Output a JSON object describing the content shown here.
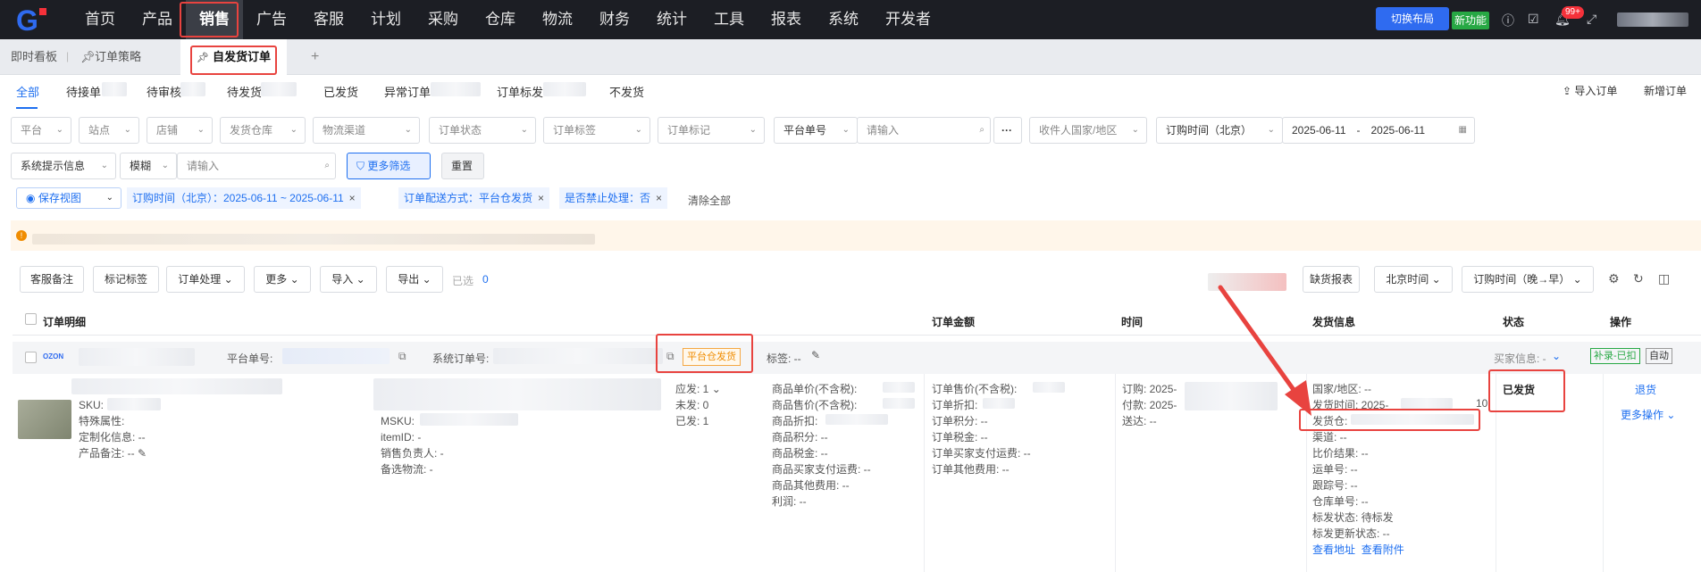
{
  "topnav": {
    "logo": "G",
    "items": [
      "首页",
      "产品",
      "销售",
      "广告",
      "客服",
      "计划",
      "采购",
      "仓库",
      "物流",
      "财务",
      "统计",
      "工具",
      "报表",
      "系统",
      "开发者"
    ],
    "layout_button": "切换布局",
    "new_feature": "新功能",
    "badge": "99+"
  },
  "tabs": {
    "items": [
      "即时看板",
      "订单策略",
      "自发货订单"
    ],
    "add": "+"
  },
  "status_tabs": [
    "全部",
    "待接单",
    "待审核",
    "待发货",
    "已发货",
    "异常订单",
    "订单标发",
    "不发货"
  ],
  "actions": {
    "import": "导入订单",
    "add": "新增订单"
  },
  "filters": {
    "platform": "平台",
    "site": "站点",
    "shop": "店铺",
    "warehouse": "发货仓库",
    "logistics": "物流渠道",
    "order_status": "订单状态",
    "order_tag": "订单标签",
    "order_mark": "订单标记",
    "platform_no": "平台单号",
    "input_placeholder": "请输入",
    "receiver_country": "收件人国家/地区",
    "order_time": "订购时间（北京）",
    "date_from": "2025-06-11",
    "date_sep": "-",
    "date_to": "2025-06-11",
    "sys_info": "系统提示信息",
    "fuzzy": "模糊",
    "more": "更多筛选",
    "reset": "重置"
  },
  "chips": {
    "save_view": "保存视图",
    "c1": "订购时间（北京）：2025-06-11 ~ 2025-06-11",
    "c2": "订单配送方式：平台仓发货",
    "c3": "是否禁止处理：否",
    "clear": "清除全部"
  },
  "toolbar": {
    "note": "客服备注",
    "tag": "标记标签",
    "process": "订单处理",
    "more": "更多",
    "import": "导入",
    "export": "导出",
    "selected_label": "已选",
    "selected_count": "0",
    "shortage": "缺货报表",
    "tz": "北京时间",
    "sort": "订购时间（晚→早）"
  },
  "table": {
    "headers": [
      "订单明细",
      "订单金额",
      "时间",
      "发货信息",
      "状态",
      "操作"
    ]
  },
  "order": {
    "platform": "OZON",
    "platform_no_label": "平台单号:",
    "sys_no_label": "系统订单号:",
    "fulfil": "平台仓发货",
    "tags_label": "标签: --",
    "buyer_label": "买家信息: -",
    "btn_fill": "补录-已扣",
    "btn_auto": "自动",
    "left": [
      "SKU:",
      "特殊属性:",
      "定制化信息: --",
      "产品备注: --"
    ],
    "mid": [
      "MSKU:",
      "itemID: -",
      "销售负责人: -",
      "备选物流: -"
    ],
    "qty": [
      "应发: 1",
      "未发: 0",
      "已发: 1"
    ],
    "price": [
      "商品单价(不含税):",
      "商品售价(不含税):",
      "商品折扣:",
      "商品积分: --",
      "商品税金: --",
      "商品买家支付运费: --",
      "商品其他费用: --",
      "利润: --"
    ],
    "amount": [
      "订单售价(不含税):",
      "订单折扣:",
      "订单积分: --",
      "订单税金: --",
      "订单买家支付运费: --",
      "订单其他费用: --"
    ],
    "time": [
      "订购: 2025-",
      "付款: 2025-",
      "送达: --"
    ],
    "ship": [
      "国家/地区: --",
      "发货时间: 2025-",
      "发货仓:",
      "渠道: --",
      "比价结果: --",
      "运单号: --",
      "跟踪号: --",
      "仓库单号: --",
      "标发状态: 待标发",
      "标发更新状态: --"
    ],
    "ship_links": [
      "查看地址",
      "查看附件"
    ],
    "ship_suffix": "10",
    "status": "已发货",
    "ops": [
      "退货",
      "更多操作"
    ]
  },
  "colors": {
    "accent": "#1e6ff0",
    "highlight": "#e8433f"
  }
}
